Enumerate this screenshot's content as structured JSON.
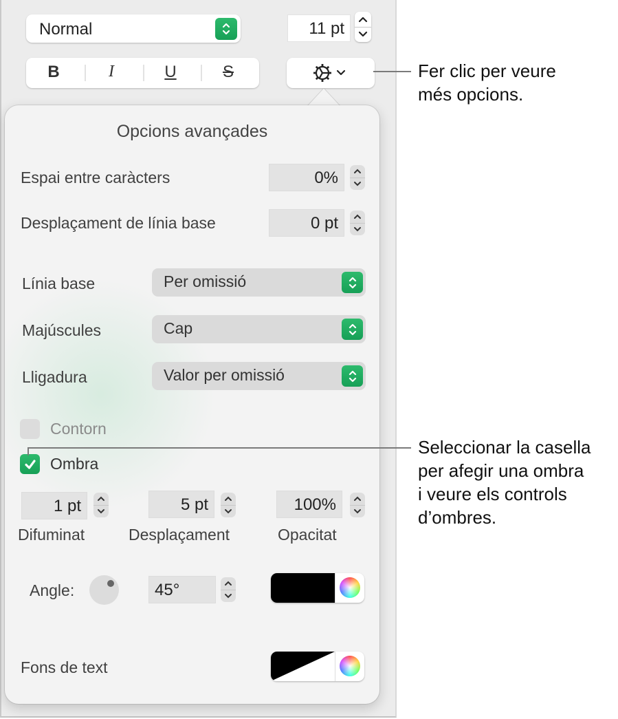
{
  "toolbar": {
    "paragraph_style": "Normal",
    "font_size": "11 pt",
    "format_buttons": [
      {
        "label": "B",
        "name": "bold"
      },
      {
        "label": "I",
        "name": "italic"
      },
      {
        "label": "U",
        "name": "underline"
      },
      {
        "label": "S",
        "name": "strikethrough"
      }
    ],
    "advanced_options_icon": "gear-icon"
  },
  "popover": {
    "title": "Opcions avançades",
    "character_spacing": {
      "label": "Espai entre caràcters",
      "value": "0%"
    },
    "baseline_shift": {
      "label": "Desplaçament de línia base",
      "value": "0 pt"
    },
    "baseline": {
      "label": "Línia base",
      "value": "Per omissió"
    },
    "capitalization": {
      "label": "Majúscules",
      "value": "Cap"
    },
    "ligatures": {
      "label": "Lligadura",
      "value": "Valor per omissió"
    },
    "outline": {
      "label": "Contorn",
      "checked": false
    },
    "shadow": {
      "label": "Ombra",
      "checked": true,
      "blur": {
        "label": "Difuminat",
        "value": "1 pt"
      },
      "offset": {
        "label": "Desplaçament",
        "value": "5 pt"
      },
      "opacity": {
        "label": "Opacitat",
        "value": "100%"
      },
      "angle": {
        "label": "Angle:",
        "value": "45°",
        "degrees": 45
      },
      "color": "#000000"
    },
    "text_background": {
      "label": "Fons de text",
      "color": "none"
    }
  },
  "callouts": {
    "gear": "Fer clic per veure\nmés opcions.",
    "shadow": "Seleccionar la casella\nper afegir una ombra\ni veure els controls\nd’ombres."
  },
  "colors": {
    "accent_green": "#1fae60"
  }
}
